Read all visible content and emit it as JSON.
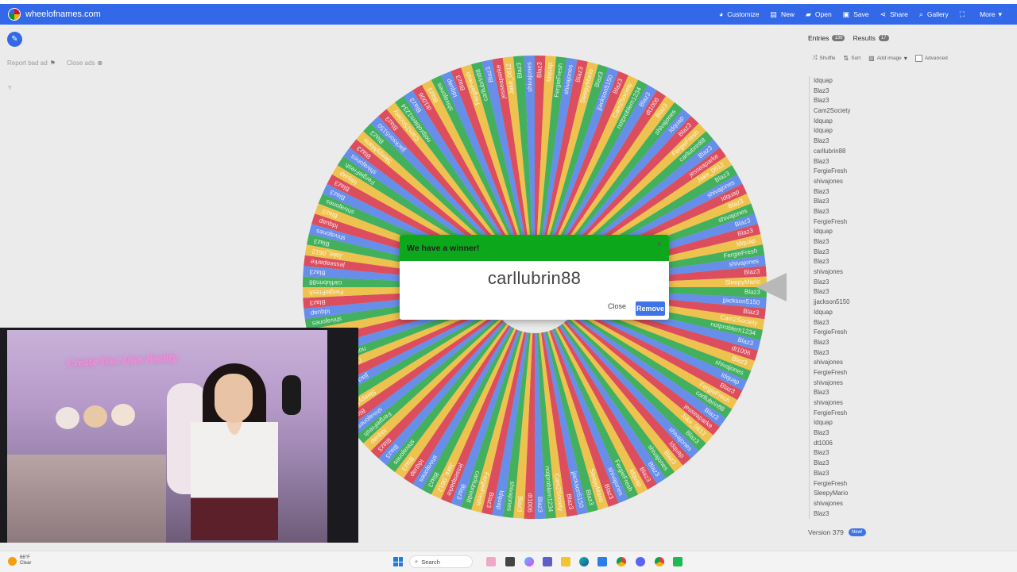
{
  "site": {
    "name": "wheelofnames.com"
  },
  "menu": [
    {
      "icon": "palette-icon",
      "label": "Customize"
    },
    {
      "icon": "new-file-icon",
      "label": "New"
    },
    {
      "icon": "folder-icon",
      "label": "Open"
    },
    {
      "icon": "save-icon",
      "label": "Save"
    },
    {
      "icon": "share-icon",
      "label": "Share"
    },
    {
      "icon": "search-icon",
      "label": "Gallery"
    },
    {
      "icon": "fullscreen-icon",
      "label": ""
    },
    {
      "icon": "chevron-down-icon",
      "label": "More"
    }
  ],
  "ads": {
    "report": "Report bad ad",
    "close": "Close ads"
  },
  "tiny_text": "Y",
  "wheel": {
    "colors": [
      "#d50f25",
      "#eeb211",
      "#009925",
      "#3369e8"
    ],
    "slice_count": 136,
    "labels": [
      "Blaz3",
      "Idquap",
      "FergieFresh",
      "shivajones",
      "Blaz3",
      "SleepyMario",
      "Blaz3",
      "jjackson5150",
      "Blaz3",
      "Cam2Society",
      "notproblem1234",
      "Blaz3",
      "dt1006",
      "Blaz3",
      "shivajones",
      "Idquap",
      "Blaz3",
      "FergieFresh",
      "carllubrin88",
      "Blaz3",
      "jesseaparke",
      "Jake_0612",
      "Blaz3",
      "shivajones",
      "Idquap",
      "Blaz3",
      "shivajones",
      "Blaz3"
    ]
  },
  "dialog": {
    "title": "We have a winner!",
    "close_x": "×",
    "winner": "carllubrin88",
    "close_btn": "Close",
    "remove_btn": "Remove"
  },
  "panel": {
    "tabs": [
      {
        "label": "Entries",
        "count": "139"
      },
      {
        "label": "Results",
        "count": "17"
      }
    ],
    "toolbar": {
      "shuffle": "Shuffle",
      "sort": "Sort",
      "add_image": "Add image",
      "advanced": "Advanced"
    },
    "entries": [
      "Idquap",
      "Blaz3",
      "Blaz3",
      "Cam2Society",
      "Idquap",
      "Idquap",
      "Blaz3",
      "carllubrin88",
      "Blaz3",
      "FergieFresh",
      "shivajones",
      "Blaz3",
      "Blaz3",
      "Blaz3",
      "FergieFresh",
      "Idquap",
      "Blaz3",
      "Blaz3",
      "Blaz3",
      "shivajones",
      "Blaz3",
      "Blaz3",
      "jjackson5150",
      "Idquap",
      "Blaz3",
      "FergieFresh",
      "Blaz3",
      "Blaz3",
      "shivajones",
      "FergieFresh",
      "shivajones",
      "Blaz3",
      "shivajones",
      "FergieFresh",
      "Idquap",
      "Blaz3",
      "dt1006",
      "Blaz3",
      "Blaz3",
      "Blaz3",
      "FergieFresh",
      "SleepyMario",
      "shivajones",
      "Blaz3"
    ],
    "version": "Version 379",
    "new_badge": "New!"
  },
  "webcam": {
    "neon_sign": "Create Your Own Reality"
  },
  "taskbar": {
    "weather_temp": "66°F",
    "weather_desc": "Clear",
    "search": "Search"
  }
}
